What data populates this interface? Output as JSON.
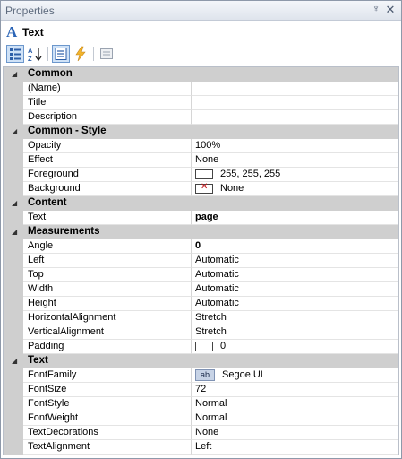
{
  "panel": {
    "title": "Properties",
    "pin_glyph": "♆",
    "close_glyph": "✕"
  },
  "object": {
    "type_icon": "A",
    "name": "Text"
  },
  "toolbar": {
    "buttons": [
      {
        "icon": "categorized-view-icon",
        "active": true
      },
      {
        "icon": "sort-alphabetical-icon",
        "active": false
      },
      {
        "icon": "properties-list-icon",
        "active": true
      },
      {
        "icon": "events-lightning-icon",
        "active": false
      },
      {
        "icon": "property-pages-icon",
        "active": false
      }
    ]
  },
  "categories": [
    {
      "label": "Common",
      "expander": "◢",
      "props": [
        {
          "name": "(Name)",
          "value": ""
        },
        {
          "name": "Title",
          "value": ""
        },
        {
          "name": "Description",
          "value": ""
        }
      ]
    },
    {
      "label": "Common - Style",
      "expander": "◢",
      "props": [
        {
          "name": "Opacity",
          "value": "100%"
        },
        {
          "name": "Effect",
          "value": "None"
        },
        {
          "name": "Foreground",
          "value": "255, 255, 255",
          "swatch": "white",
          "swatch_color": "#ffffff"
        },
        {
          "name": "Background",
          "value": "None",
          "swatch": "none"
        }
      ]
    },
    {
      "label": "Content",
      "expander": "◢",
      "props": [
        {
          "name": "Text",
          "value": "page",
          "bold": true
        }
      ]
    },
    {
      "label": "Measurements",
      "expander": "◢",
      "props": [
        {
          "name": "Angle",
          "value": "0",
          "bold": true
        },
        {
          "name": "Left",
          "value": "Automatic"
        },
        {
          "name": "Top",
          "value": "Automatic"
        },
        {
          "name": "Width",
          "value": "Automatic"
        },
        {
          "name": "Height",
          "value": "Automatic"
        },
        {
          "name": "HorizontalAlignment",
          "value": "Stretch"
        },
        {
          "name": "VerticalAlignment",
          "value": "Stretch"
        },
        {
          "name": "Padding",
          "value": "0",
          "swatch": "white",
          "swatch_color": "#ffffff"
        }
      ]
    },
    {
      "label": "Text",
      "expander": "◢",
      "props": [
        {
          "name": "FontFamily",
          "value": "Segoe UI",
          "font_glyph": "ab"
        },
        {
          "name": "FontSize",
          "value": "72"
        },
        {
          "name": "FontStyle",
          "value": "Normal"
        },
        {
          "name": "FontWeight",
          "value": "Normal"
        },
        {
          "name": "TextDecorations",
          "value": "None"
        },
        {
          "name": "TextAlignment",
          "value": "Left"
        }
      ]
    }
  ]
}
